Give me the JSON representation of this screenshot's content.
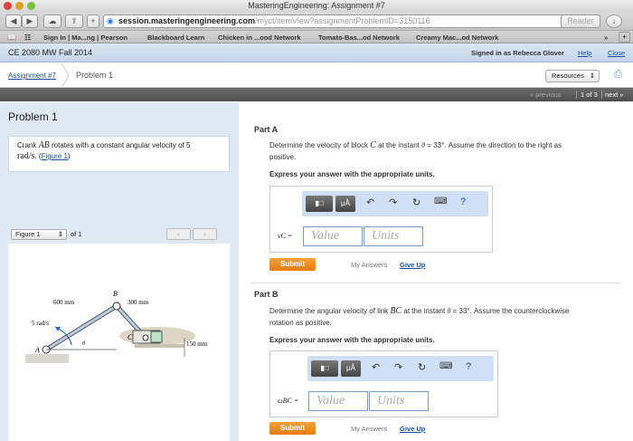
{
  "window": {
    "title": "MasteringEngineering: Assignment #7"
  },
  "browser": {
    "url_host": "session.masteringengineering.com",
    "url_path": "/myct/itemView?assignmentProblemID=3150116",
    "reader_label": "Reader"
  },
  "bookmarks": [
    "Sign In | Ma...ng | Pearson",
    "Blackboard Learn",
    "Chicken in ...ood Network",
    "Tomato-Bas...od Network",
    "Creamy Mac...od Network"
  ],
  "course": {
    "title": "CE 2080 MW Fall 2014",
    "signed_in": "Signed in as Rebecca Glover",
    "help": "Help",
    "close": "Close"
  },
  "crumbs": {
    "assignment": "Assignment #7",
    "problem": "Problem 1",
    "resources": "Resources"
  },
  "pager": {
    "previous": "« previous",
    "position": "1 of 3",
    "next": "next »"
  },
  "problem": {
    "title": "Problem 1",
    "text_pre": "Crank ",
    "text_var": "AB",
    "text_post": " rotates with a constant angular velocity of 5",
    "units": "rad/s",
    "figure_link": "Figure 1",
    "figure_select": "Figure 1",
    "figure_of": "of 1"
  },
  "figure": {
    "label_b": "B",
    "label_a": "A",
    "label_c": "C",
    "dim_ab": "600 mm",
    "dim_bc": "300 mm",
    "dim_h": "150 mm",
    "omega": "5 rad/s",
    "theta": "θ"
  },
  "part_a": {
    "label": "Part A",
    "q1": "Determine the velocity of block ",
    "q_var": "C",
    "q2": " at the instant ",
    "q_theta": "θ",
    "q3": " = 33°. Assume the direction to the right as",
    "q4": "positive.",
    "instr": "Express your answer with the appropriate units.",
    "var_label": "vC =",
    "value_ph": "Value",
    "units_ph": "Units",
    "submit": "Submit",
    "my_answers": "My Answers",
    "give_up": "Give Up"
  },
  "part_b": {
    "label": "Part B",
    "q1": "Determine the angular velocity of link ",
    "q_var": "BC",
    "q2": " at the instant ",
    "q_theta": "θ",
    "q3": " = 33°. Assume the counterclockwise",
    "q4": "rotation as positive.",
    "instr": "Express your answer with the appropriate units.",
    "var_label": "ωBC =",
    "value_ph": "Value",
    "units_ph": "Units",
    "submit": "Submit",
    "my_answers": "My Answers",
    "give_up": "Give Up"
  },
  "mathbar": {
    "templates": "▮□",
    "units": "μÅ",
    "help": "?"
  },
  "colors": {
    "accent_orange": "#e8871e",
    "link": "#1a4f9c",
    "panel": "#dfe9f4"
  }
}
